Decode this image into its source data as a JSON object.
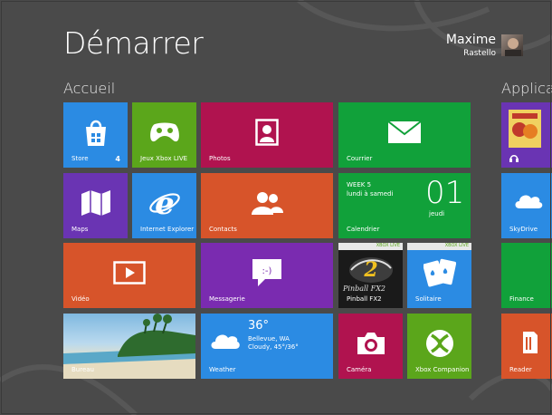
{
  "header": {
    "title": "Démarrer",
    "user_first": "Maxime",
    "user_last": "Rastello"
  },
  "groups": {
    "accueil": "Accueil",
    "applications": "Applicat"
  },
  "tiles": {
    "store": {
      "label": "Store",
      "badge": "4",
      "color": "#2b8be3"
    },
    "xbox_games": {
      "label": "Jeux Xbox LIVE",
      "color": "#5ba61b"
    },
    "photos": {
      "label": "Photos",
      "color": "#b0134f"
    },
    "courrier": {
      "label": "Courrier",
      "color": "#11a13a"
    },
    "maps": {
      "label": "Maps",
      "color": "#6a34b3"
    },
    "ie": {
      "label": "Internet Explorer",
      "color": "#2b8be3"
    },
    "contacts": {
      "label": "Contacts",
      "color": "#d7542a"
    },
    "calendrier": {
      "label": "Calendrier",
      "week": "WEEK 5",
      "days": "lundi à samedi",
      "date": "01",
      "weekday": "jeudi",
      "color": "#11a13a"
    },
    "video": {
      "label": "Vidéo",
      "color": "#d7542a"
    },
    "messagerie": {
      "label": "Messagerie",
      "color": "#7a2bb0"
    },
    "pinball": {
      "label": "Pinball FX2",
      "tag": "XBOX LIVE",
      "logo": "Pinball FX2",
      "color": "#1a1a1a"
    },
    "solitaire": {
      "label": "Solitaire",
      "tag": "XBOX LIVE",
      "color": "#2b8be3"
    },
    "bureau": {
      "label": "Bureau"
    },
    "weather": {
      "label": "Weather",
      "temp": "36°",
      "city": "Bellevue, WA",
      "cond": "Cloudy, 45°/36°",
      "color": "#2b8be3"
    },
    "camera": {
      "label": "Caméra",
      "color": "#b0134f"
    },
    "xbox_companion": {
      "label": "Xbox Companion",
      "color": "#5ba61b"
    },
    "skydrive": {
      "label": "SkyDrive",
      "color": "#2b8be3"
    },
    "finance": {
      "label": "Finance",
      "color": "#11a13a"
    },
    "reader": {
      "label": "Reader",
      "color": "#d7542a"
    }
  }
}
